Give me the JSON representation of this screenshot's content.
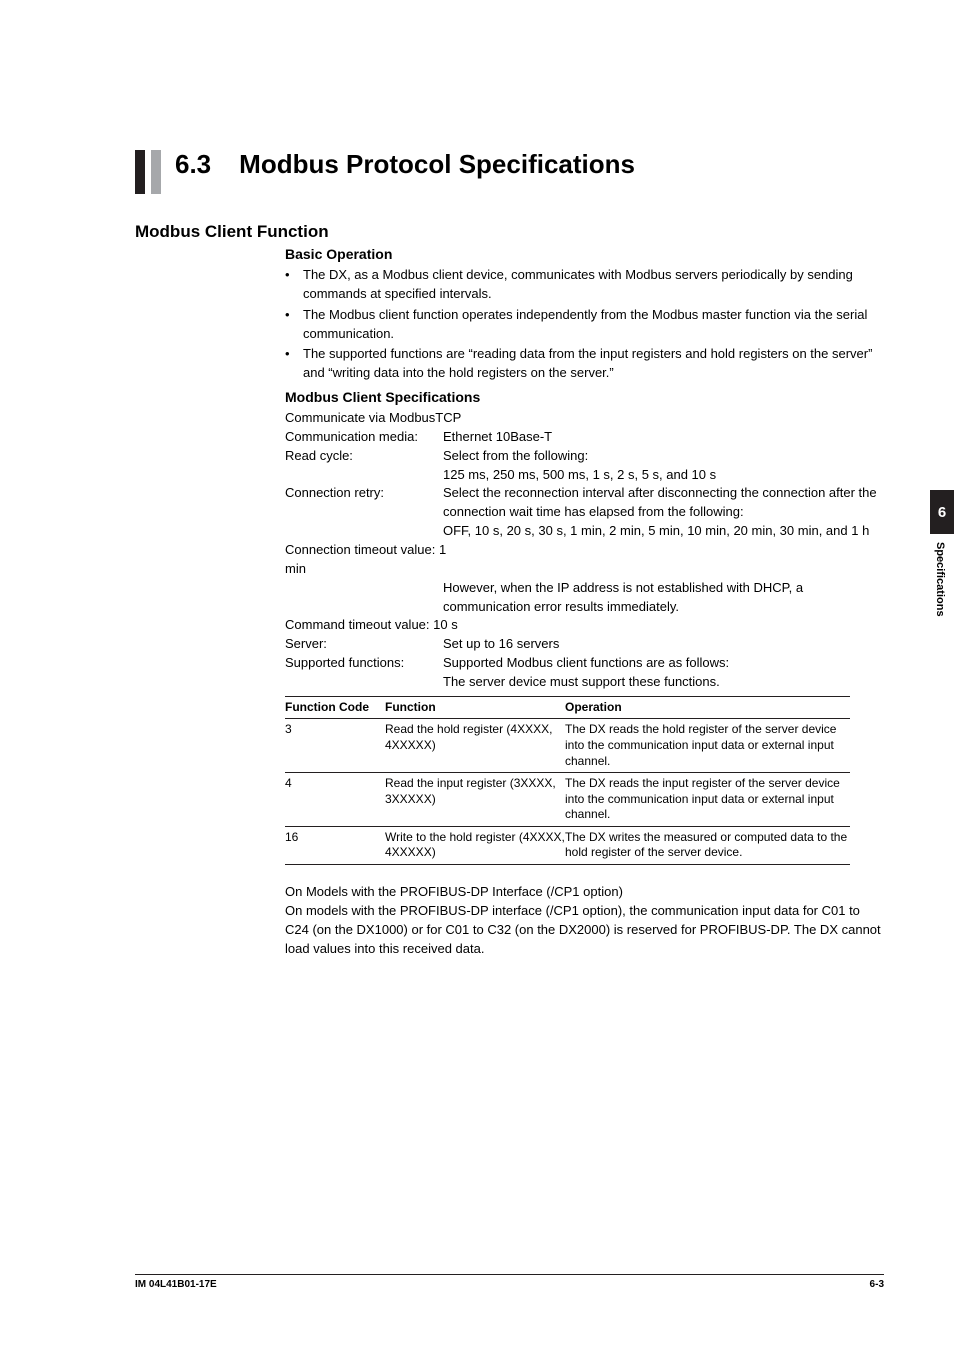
{
  "section": {
    "number": "6.3",
    "title": "Modbus Protocol Specifications"
  },
  "h2": "Modbus Client Function",
  "basic": {
    "heading": "Basic Operation",
    "bullets": [
      "The DX, as a Modbus client device, communicates with Modbus servers periodically by sending commands at specified intervals.",
      "The Modbus client function operates independently from the Modbus master function via the serial communication.",
      "The supported functions are “reading data from the input registers and hold registers on the server” and “writing data into the hold registers on the server.”"
    ]
  },
  "specs": {
    "heading": "Modbus Client Specifications",
    "intro": "Communicate via ModbusTCP",
    "rows": {
      "comm_media": {
        "label": "Communication media:",
        "value": "Ethernet 10Base-T"
      },
      "read_cycle": {
        "label": "Read cycle:",
        "value1": "Select from the following:",
        "value2": "125 ms, 250 ms, 500 ms, 1 s, 2 s, 5 s, and 10 s"
      },
      "conn_retry": {
        "label": "Connection retry:",
        "value1": "Select the reconnection interval after disconnecting the connection after the connection wait time has elapsed from the following:",
        "value2": "OFF, 10 s, 20 s, 30 s, 1 min, 2 min, 5 min, 10 min, 20 min, 30 min, and 1 h"
      },
      "conn_timeout": {
        "label": "Connection timeout value:",
        "value1": "1 min",
        "value2": "However, when the IP address is not established with DHCP, a communication error results immediately."
      },
      "cmd_timeout": {
        "label": "Command timeout value:",
        "value": "10 s"
      },
      "server": {
        "label": "Server:",
        "value": "Set up to 16 servers"
      },
      "supported": {
        "label": "Supported functions:",
        "value1": "Supported Modbus client functions are as follows:",
        "value2": "The server device must support these functions."
      }
    }
  },
  "table": {
    "headers": {
      "c1": "Function Code",
      "c2": "Function",
      "c3": "Operation"
    },
    "rows": [
      {
        "code": "3",
        "func": "Read the hold register (4XXXX, 4XXXXX)",
        "op": "The DX reads the hold register of the server device into the communication input data or external input channel."
      },
      {
        "code": "4",
        "func": "Read the input register (3XXXX, 3XXXXX)",
        "op": "The DX reads the input register of the server device into the communication input data or external input channel."
      },
      {
        "code": "16",
        "func": "Write to the hold register (4XXXX, 4XXXXX)",
        "op": "The DX writes the measured or computed data to the hold register of the server device."
      }
    ]
  },
  "after": {
    "line1": "On Models with the PROFIBUS-DP Interface (/CP1 option)",
    "line2": "On models with the PROFIBUS-DP interface (/CP1 option), the communication input data for C01 to C24 (on the DX1000) or for C01 to C32 (on the DX2000) is reserved for PROFIBUS-DP. The DX cannot load values into this received data."
  },
  "sidetab": {
    "chapter": "6",
    "label": "Specifications"
  },
  "footer": {
    "left": "IM 04L41B01-17E",
    "right": "6-3"
  },
  "chart_data": {
    "type": "table",
    "title": "Supported Modbus client functions",
    "columns": [
      "Function Code",
      "Function",
      "Operation"
    ],
    "rows": [
      [
        "3",
        "Read the hold register (4XXXX, 4XXXXX)",
        "The DX reads the hold register of the server device into the communication input data or external input channel."
      ],
      [
        "4",
        "Read the input register (3XXXX, 3XXXXX)",
        "The DX reads the input register of the server device into the communication input data or external input channel."
      ],
      [
        "16",
        "Write to the hold register (4XXXX, 4XXXXX)",
        "The DX writes the measured or computed data to the hold register of the server device."
      ]
    ]
  }
}
